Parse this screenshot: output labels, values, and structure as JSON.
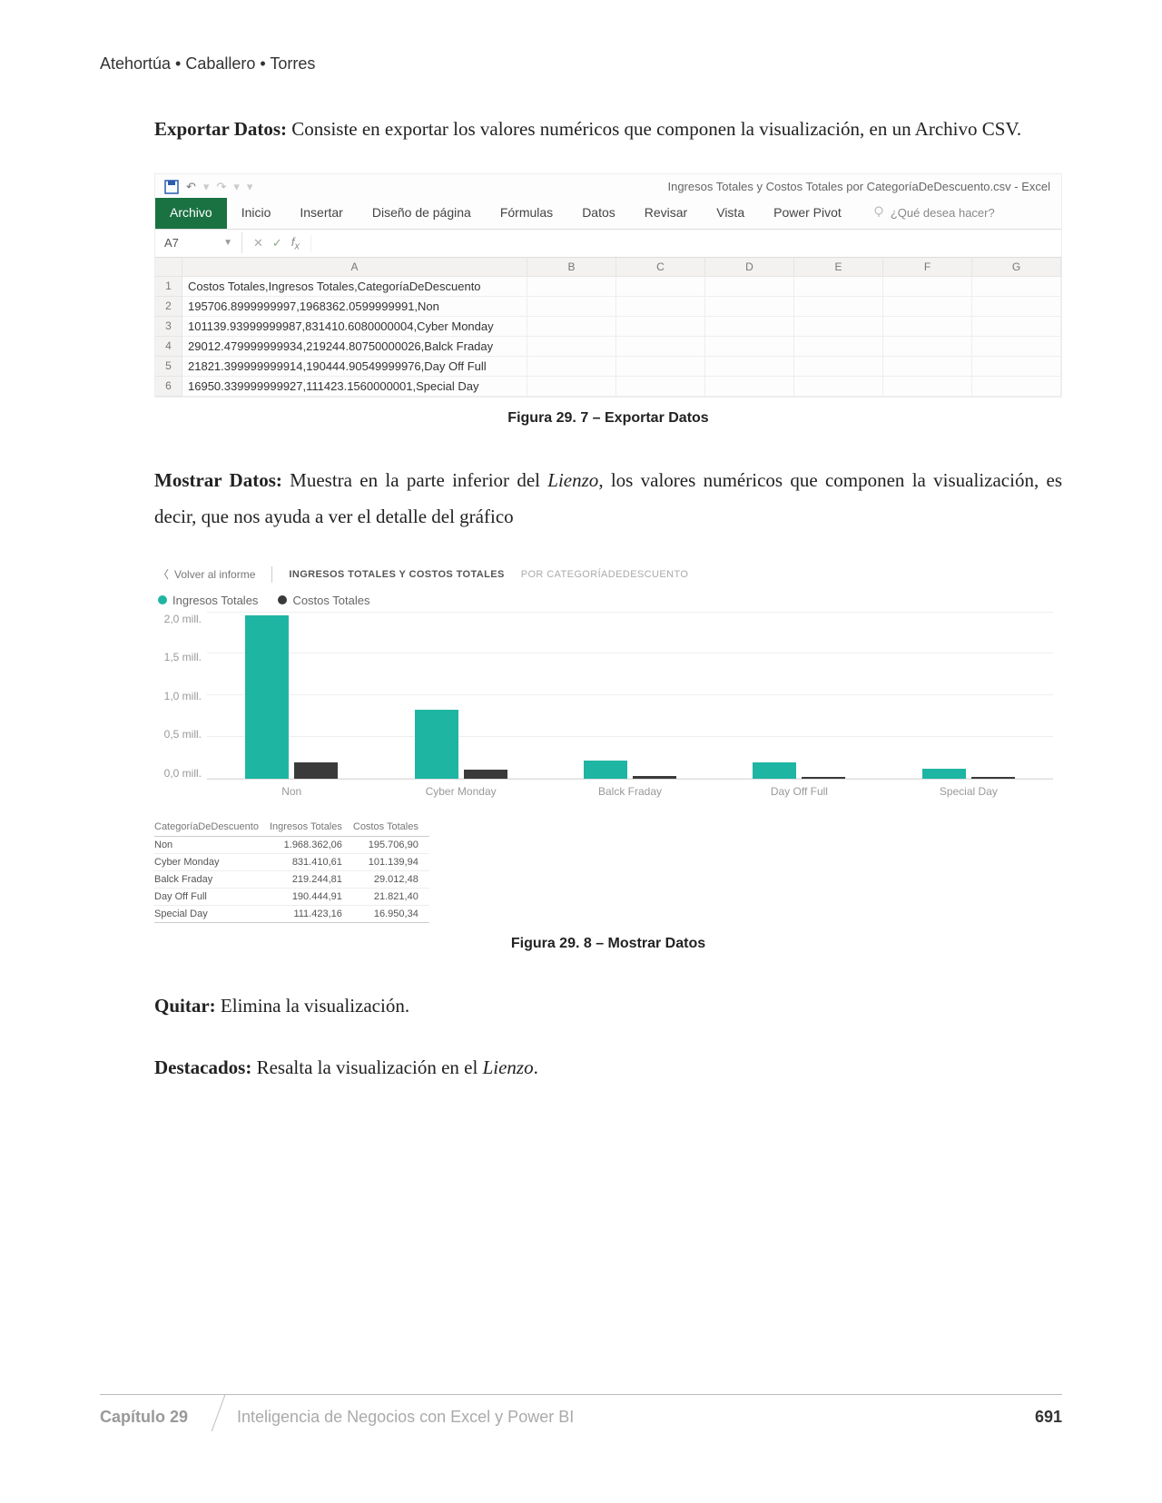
{
  "header": {
    "authors": "Atehortúa • Caballero • Torres"
  },
  "para1": {
    "bold": "Exportar Datos:",
    "text": "  Consiste en exportar los valores numéricos que componen la visualización, en un Archivo CSV."
  },
  "excel": {
    "title": "Ingresos Totales y Costos Totales por CategoríaDeDescuento.csv - Excel",
    "tabs": [
      "Archivo",
      "Inicio",
      "Insertar",
      "Diseño de página",
      "Fórmulas",
      "Datos",
      "Revisar",
      "Vista",
      "Power Pivot"
    ],
    "tellme": "¿Qué desea hacer?",
    "namebox": "A7",
    "columns": [
      "A",
      "B",
      "C",
      "D",
      "E",
      "F",
      "G"
    ],
    "rows": [
      "Costos Totales,Ingresos Totales,CategoríaDeDescuento",
      "195706.8999999997,1968362.0599999991,Non",
      "101139.93999999987,831410.6080000004,Cyber Monday",
      "29012.479999999934,219244.80750000026,Balck Fraday",
      "21821.399999999914,190444.90549999976,Day Off Full",
      "16950.339999999927,111423.1560000001,Special Day"
    ]
  },
  "fig1_caption": "Figura 29. 7 – Exportar Datos",
  "para2": {
    "bold": "Mostrar Datos:",
    "text1": " Muestra en la parte inferior del ",
    "italic": "Lienzo",
    "text2": ", los valores numéricos que componen la visualización, es decir, que nos ayuda a ver el detalle del gráfico"
  },
  "pbi": {
    "back": "Volver al informe",
    "title_strong": "INGRESOS TOTALES Y COSTOS TOTALES",
    "title_light": "POR CATEGORÍADEDESCUENTO",
    "legend": {
      "ingresos": "Ingresos Totales",
      "costos": "Costos Totales"
    },
    "yticks": [
      "2,0 mill.",
      "1,5 mill.",
      "1,0 mill.",
      "0,5 mill.",
      "0,0 mill."
    ],
    "categories": [
      "Non",
      "Cyber Monday",
      "Balck Fraday",
      "Day Off Full",
      "Special Day"
    ],
    "table": {
      "headers": [
        "CategoríaDeDescuento",
        "Ingresos Totales",
        "Costos Totales"
      ],
      "rows": [
        [
          "Non",
          "1.968.362,06",
          "195.706,90"
        ],
        [
          "Cyber Monday",
          "831.410,61",
          "101.139,94"
        ],
        [
          "Balck Fraday",
          "219.244,81",
          "29.012,48"
        ],
        [
          "Day Off Full",
          "190.444,91",
          "21.821,40"
        ],
        [
          "Special Day",
          "111.423,16",
          "16.950,34"
        ]
      ]
    }
  },
  "chart_data": {
    "type": "bar",
    "title": "INGRESOS TOTALES Y COSTOS TOTALES POR CATEGORÍADEDESCUENTO",
    "xlabel": "CategoríaDeDescuento",
    "ylabel": "",
    "ylim": [
      0,
      2000000
    ],
    "yticks": [
      0,
      500000,
      1000000,
      1500000,
      2000000
    ],
    "categories": [
      "Non",
      "Cyber Monday",
      "Balck Fraday",
      "Day Off Full",
      "Special Day"
    ],
    "series": [
      {
        "name": "Ingresos Totales",
        "color": "#1fb5a3",
        "values": [
          1968362.06,
          831410.61,
          219244.81,
          190444.91,
          111423.16
        ]
      },
      {
        "name": "Costos Totales",
        "color": "#3a3a3a",
        "values": [
          195706.9,
          101139.94,
          29012.48,
          21821.4,
          16950.34
        ]
      }
    ],
    "legend_position": "top-left"
  },
  "fig2_caption": "Figura 29. 8 – Mostrar Datos",
  "para3": {
    "bold": "Quitar:",
    "text": "  Elimina la visualización."
  },
  "para4": {
    "bold": "Destacados:",
    "text1": " Resalta la visualización en el ",
    "italic": "Lienzo",
    "text2": "."
  },
  "footer": {
    "chapter": "Capítulo 29",
    "subtitle": "Inteligencia de Negocios con Excel y Power BI",
    "page": "691"
  },
  "colors": {
    "excel_green": "#1a7243",
    "teal": "#1fb5a3",
    "dark": "#3a3a3a"
  }
}
